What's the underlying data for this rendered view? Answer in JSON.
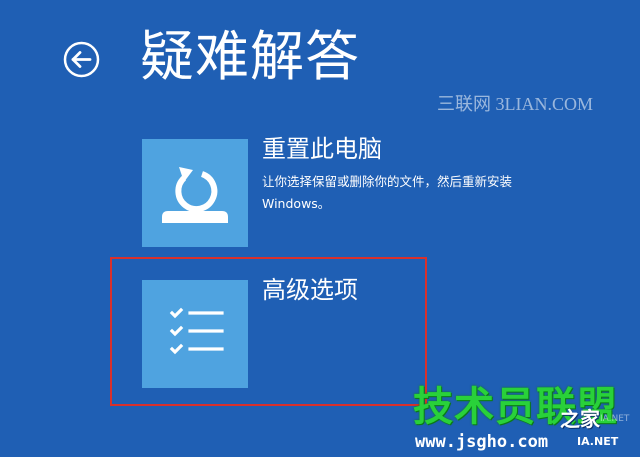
{
  "header": {
    "title": "疑难解答",
    "back_icon": "back-arrow-icon"
  },
  "options": [
    {
      "title": "重置此电脑",
      "description": "让你选择保留或删除你的文件，然后重新安装 Windows。",
      "icon": "reset-pc-icon"
    },
    {
      "title": "高级选项",
      "description": "",
      "icon": "advanced-options-checklist-icon"
    }
  ],
  "watermarks": {
    "top": "三联网 3LIAN.COM",
    "bottom_brand": "技术员联盟",
    "bottom_brand_suffix": "之家",
    "bottom_url": "www.jsgho.com",
    "bottom_url_tail": "IA.NET",
    "bottom_faded": "IA.NET"
  },
  "colors": {
    "background": "#1f5fb4",
    "tile": "#4fa3e0",
    "highlight": "#d9302c",
    "watermark_green": "#29d13a"
  }
}
